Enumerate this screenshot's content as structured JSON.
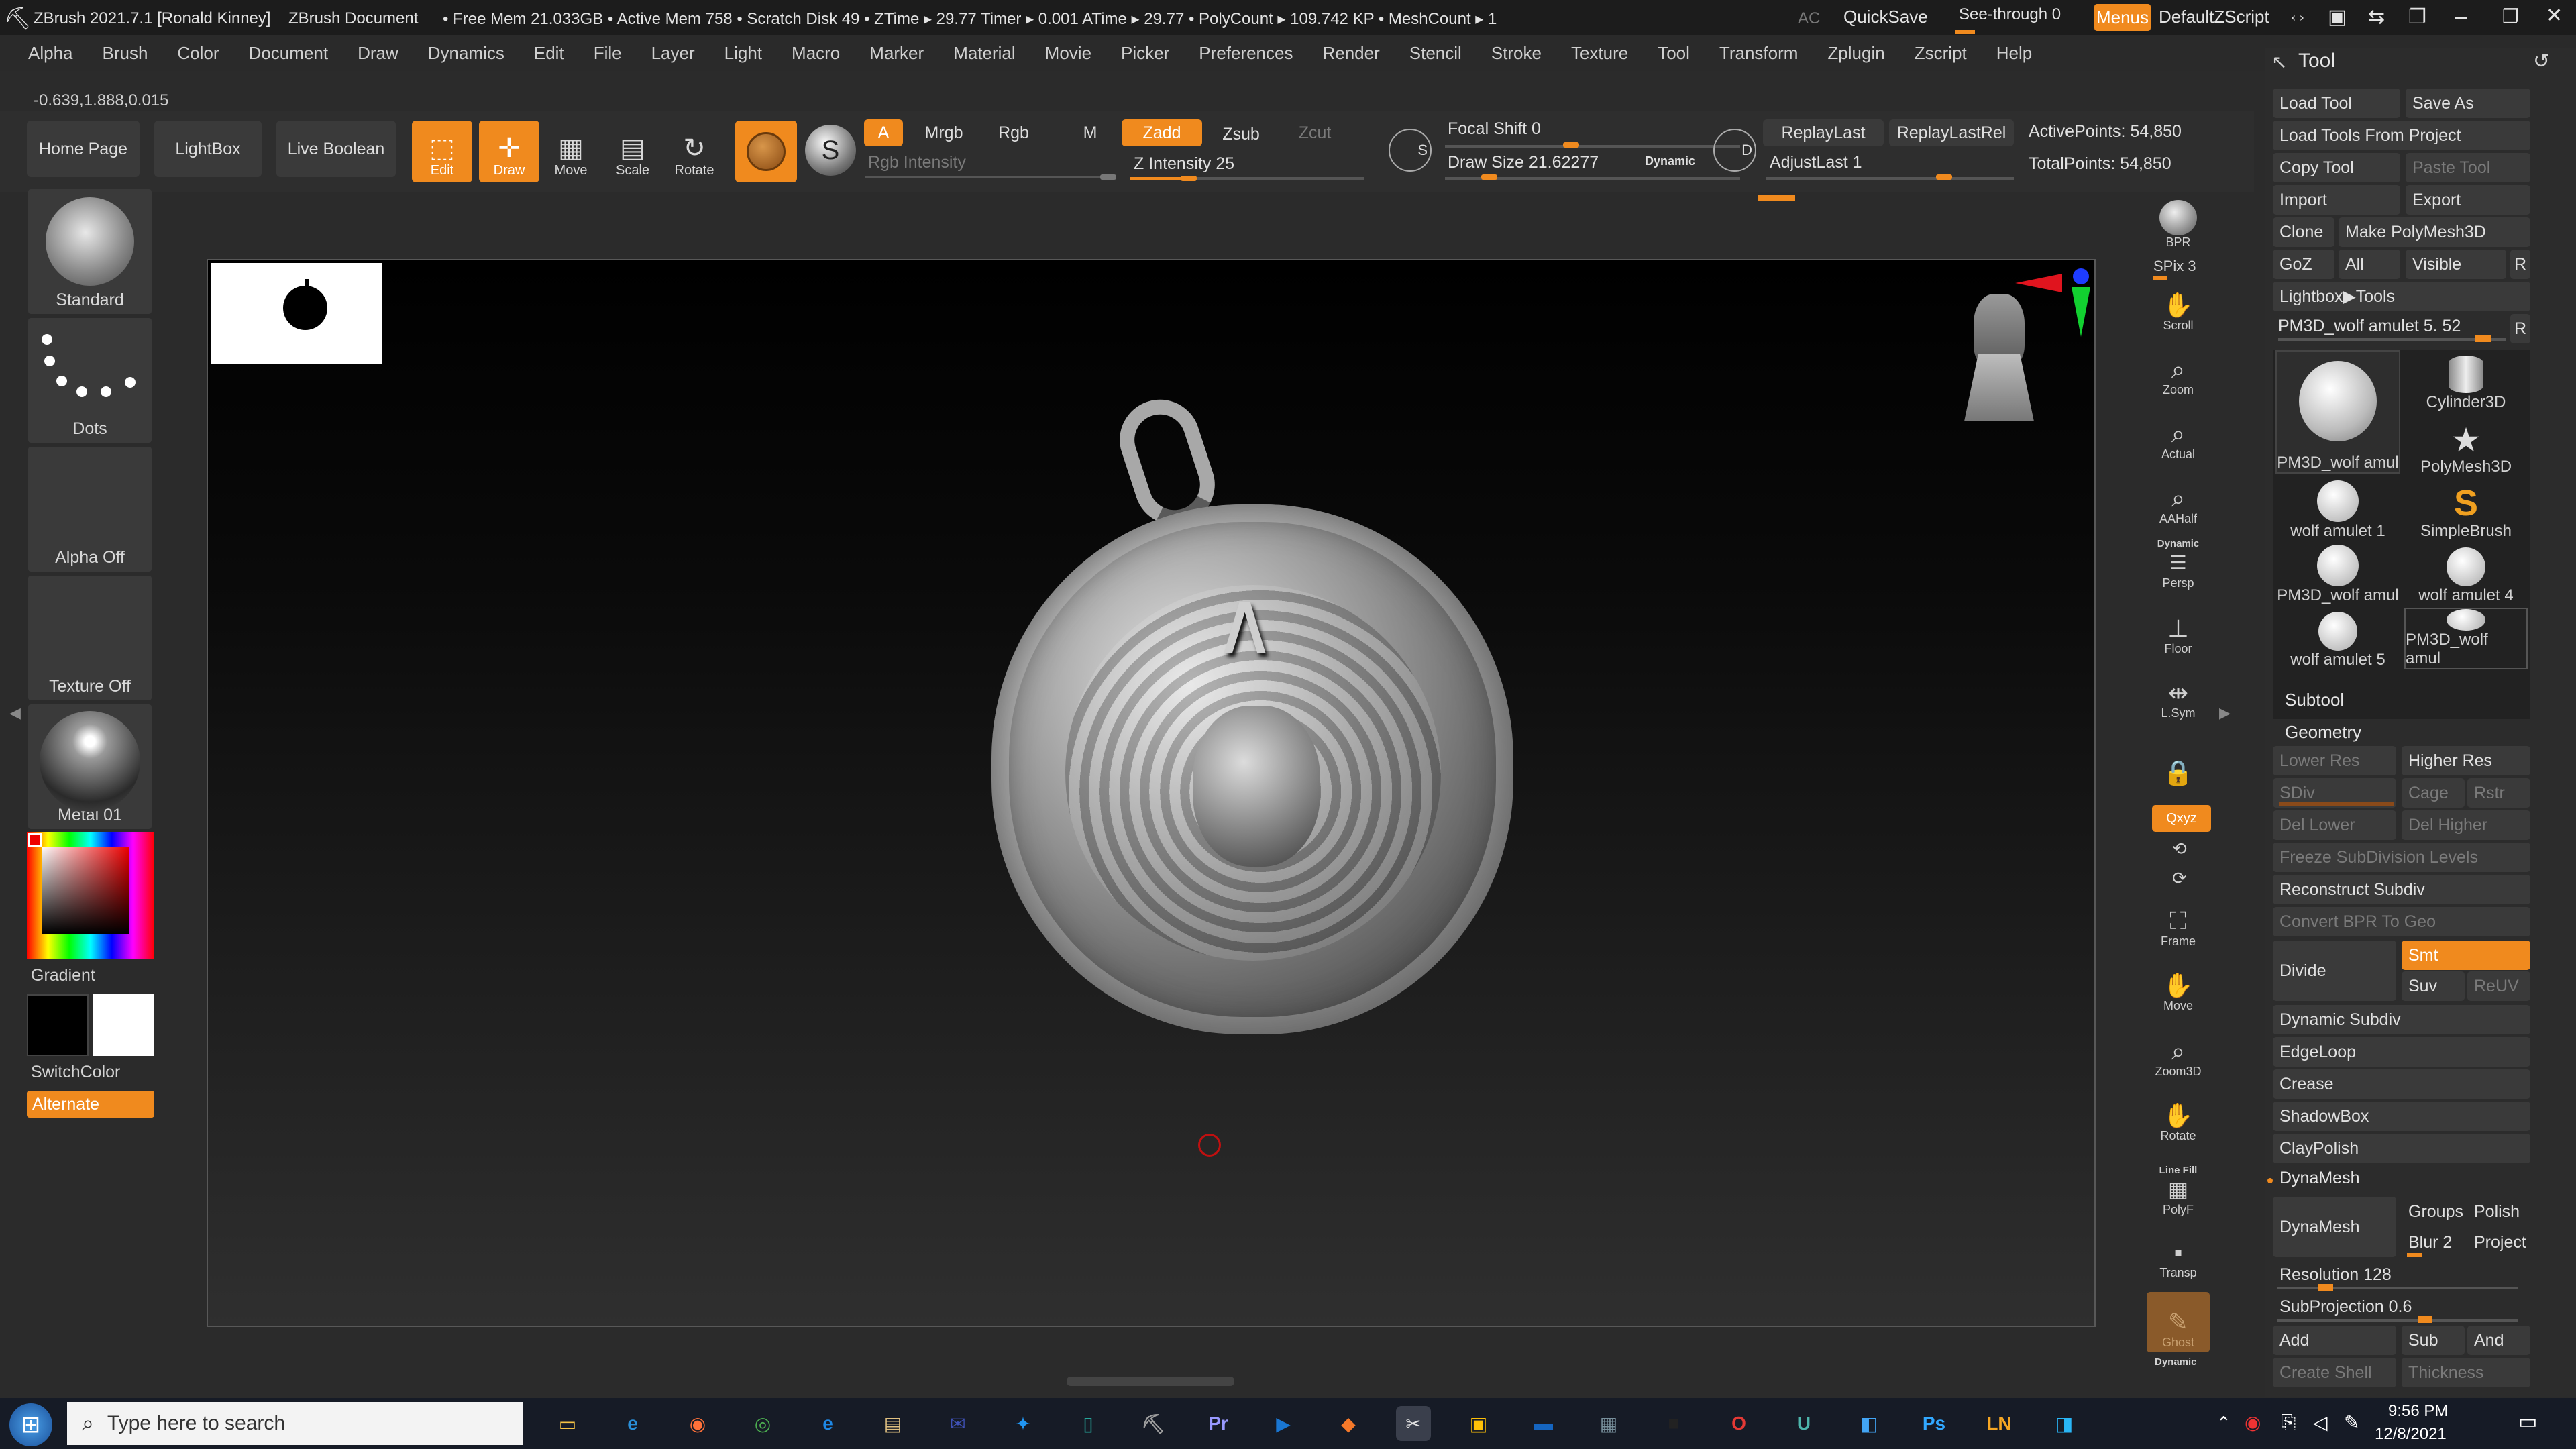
{
  "title": {
    "app": "ZBrush 2021.7.1 [Ronald Kinney]",
    "doc": "ZBrush Document",
    "stats": "• Free Mem 21.033GB • Active Mem 758 • Scratch Disk 49 • ZTime ▸ 29.77 Timer ▸ 0.001 ATime ▸ 29.77 • PolyCount ▸ 109.742 KP • MeshCount ▸ 1",
    "ac": "AC",
    "quicksave": "QuickSave",
    "seethrough": "See-through 0",
    "menus": "Menus",
    "zscript": "DefaultZScript"
  },
  "menu": [
    "Alpha",
    "Brush",
    "Color",
    "Document",
    "Draw",
    "Dynamics",
    "Edit",
    "File",
    "Layer",
    "Light",
    "Macro",
    "Marker",
    "Material",
    "Movie",
    "Picker",
    "Preferences",
    "Render",
    "Stencil",
    "Stroke",
    "Texture",
    "Tool",
    "Transform",
    "Zplugin",
    "Zscript",
    "Help"
  ],
  "coords": "-0.639,1.888,0.015",
  "shelf": {
    "home": "Home Page",
    "lightbox": "LightBox",
    "liveboolean": "Live Boolean",
    "edit": "Edit",
    "draw": "Draw",
    "move": "Move",
    "scale": "Scale",
    "rotate": "Rotate",
    "a": "A",
    "mrgb": "Mrgb",
    "rgb": "Rgb",
    "m": "M",
    "zadd": "Zadd",
    "zsub": "Zsub",
    "zcut": "Zcut",
    "rgbintensity": "Rgb Intensity",
    "zintensity": "Z Intensity 25",
    "zintensity_value": 25,
    "focalshift": "Focal Shift 0",
    "drawsize": "Draw Size 21.62277",
    "dynamic": "Dynamic",
    "replaylast": "ReplayLast",
    "replaylastrel": "ReplayLastRel",
    "adjustlast": "AdjustLast 1",
    "activepoints": "ActivePoints: 54,850",
    "totalpoints": "TotalPoints: 54,850"
  },
  "left": {
    "standard": "Standard",
    "dots": "Dots",
    "alpha": "Alpha Off",
    "texture": "Texture Off",
    "material": "Metal 01",
    "gradient": "Gradient",
    "switchcolor": "SwitchColor",
    "alternate": "Alternate"
  },
  "right": {
    "bpr": "BPR",
    "spix": "SPix 3",
    "scroll": "Scroll",
    "zoom": "Zoom",
    "actual": "Actual",
    "aahalf": "AAHalf",
    "dynamic": "Dynamic",
    "persp": "Persp",
    "floor": "Floor",
    "lsym": "L.Sym",
    "xyz": "Qxyz",
    "frame": "Frame",
    "move": "Move",
    "zoom3d": "Zoom3D",
    "rotate": "Rotate",
    "linefill": "Line Fill",
    "polyf": "PolyF",
    "transp": "Transp",
    "ghost": "Ghost",
    "dynamic2": "Dynamic"
  },
  "tool": {
    "title": "Tool",
    "loadtool": "Load Tool",
    "saveas": "Save As",
    "loadfromproject": "Load Tools From Project",
    "copytool": "Copy Tool",
    "pastetool": "Paste Tool",
    "import": "Import",
    "export": "Export",
    "clone": "Clone",
    "makepolymesh": "Make PolyMesh3D",
    "goz": "GoZ",
    "all": "All",
    "visible": "Visible",
    "r": "R",
    "lightboxtools": "Lightbox▶Tools",
    "current": "PM3D_wolf amulet 5. 52",
    "thumbs": [
      "PM3D_wolf amul",
      "Cylinder3D",
      "wolf amulet 1",
      "SimpleBrush",
      "PM3D_wolf amul",
      "wolf amulet 4",
      "wolf amulet 5",
      "PM3D_wolf amul"
    ],
    "polymesh": "PolyMesh3D",
    "subtool": "Subtool",
    "geometry": "Geometry",
    "lowerres": "Lower Res",
    "higherres": "Higher Res",
    "sdiv": "SDiv",
    "cage": "Cage",
    "rstr": "Rstr",
    "dellower": "Del Lower",
    "delhigher": "Del Higher",
    "freeze": "Freeze SubDivision Levels",
    "reconstruct": "Reconstruct Subdiv",
    "convertbpr": "Convert BPR To Geo",
    "divide": "Divide",
    "smt": "Smt",
    "suv": "Suv",
    "reuv": "ReUV",
    "dynamicsubdiv": "Dynamic Subdiv",
    "edgeloop": "EdgeLoop",
    "crease": "Crease",
    "shadowbox": "ShadowBox",
    "claypolish": "ClayPolish",
    "dynamesh_head": "DynaMesh",
    "dynamesh": "DynaMesh",
    "groups": "Groups",
    "polish": "Polish",
    "blur": "Blur 2",
    "project": "Project",
    "resolution": "Resolution 128",
    "subprojection": "SubProjection 0.6",
    "add": "Add",
    "sub": "Sub",
    "and": "And",
    "createshell": "Create Shell",
    "thickness": "Thickness"
  },
  "taskbar": {
    "search": "Type here to search",
    "time": "9:56 PM",
    "date": "12/8/2021",
    "icons": [
      "explorer-icon",
      "edge-icon",
      "firefox-icon",
      "chrome-icon",
      "ie-icon",
      "files-icon",
      "mail-icon",
      "app-icon",
      "notes-icon",
      "zbrush-tray-icon",
      "premiere-icon",
      "media-icon",
      "blender-icon",
      "zbrush-icon",
      "app2-icon",
      "app3-icon",
      "app4-icon",
      "app5-icon",
      "opera-icon",
      "upwork-icon",
      "photos-icon",
      "photoshop-icon",
      "ln-icon",
      "app6-icon"
    ],
    "icon_colors": [
      "#f4c244",
      "#2a8fd8",
      "#ff7139",
      "#4caf50",
      "#1e88e5",
      "#e0c080",
      "#3f51b5",
      "#2196f3",
      "#26a69a",
      "#9e9e9e",
      "#9999ff",
      "#1976d2",
      "#f5792a",
      "#e0e0e0",
      "#ffc107",
      "#1565c0",
      "#78909c",
      "#222222",
      "#e53935",
      "#4db6ac",
      "#42a5f5",
      "#31a8ff",
      "#f5a623",
      "#29b6f6"
    ]
  }
}
